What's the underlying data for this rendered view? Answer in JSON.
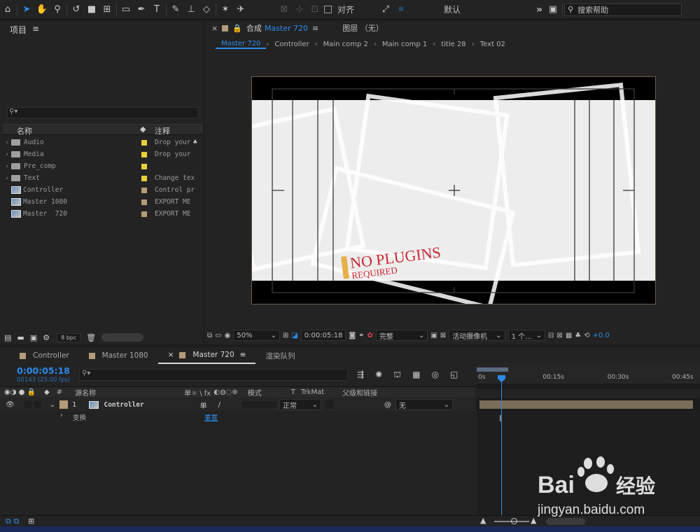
{
  "toolbar": {
    "snap_label": "对齐",
    "workspace_label": "默认",
    "search_help_placeholder": "搜索帮助",
    "expand_glyph": "»"
  },
  "project_panel": {
    "title": "项目",
    "menu_glyph": "≡",
    "columns": {
      "name": "名称",
      "comment": "注释"
    },
    "items": [
      {
        "name": "Audio",
        "type": "folder",
        "label_color": "#e6cf3c",
        "comment": "Drop your"
      },
      {
        "name": "Media",
        "type": "folder",
        "label_color": "#e6cf3c",
        "comment": "Drop your"
      },
      {
        "name": "Pre_comp",
        "type": "folder",
        "label_color": "#e6cf3c",
        "comment": ""
      },
      {
        "name": "Text",
        "type": "folder",
        "label_color": "#e6cf3c",
        "comment": "Change tex"
      },
      {
        "name": "Controller",
        "type": "comp",
        "label_color": "#b49b7a",
        "comment": "Control pr"
      },
      {
        "name": "Master 1080",
        "type": "comp",
        "label_color": "#b49b7a",
        "comment": "EXPORT ME"
      },
      {
        "name": "Master  720",
        "type": "comp",
        "label_color": "#b49b7a",
        "comment": "EXPORT ME"
      }
    ],
    "bpc": "8 bpc"
  },
  "viewer": {
    "comp_tab_prefix": "合成",
    "comp_tab_name": "Master 720",
    "comp_tab_menu": "≡",
    "layer_tab": "图层 （无）",
    "breadcrumbs": [
      "Master 720",
      "Controller",
      "Main comp 2",
      "Main comp 1",
      "title 28",
      "Text 02"
    ],
    "canvas_text_main": "NO PLUGINS",
    "canvas_text_sub": "REQUIRED",
    "zoom": "50%",
    "timecode": "0:00:05:18",
    "resolution": "完整",
    "camera": "活动摄像机",
    "views": "1 个...",
    "exposure": "+0.0"
  },
  "timeline": {
    "tabs": [
      {
        "label": "Controller",
        "active": false
      },
      {
        "label": "Master 1080",
        "active": false
      },
      {
        "label": "Master 720",
        "active": true
      },
      {
        "label": "渲染队列",
        "active": false
      }
    ],
    "close_glyph": "×",
    "timecode": "0:00:05:18",
    "fps": "00143 (25.00 fps)",
    "headers": {
      "hash": "#",
      "source_name": "源名称",
      "switches": "单☼ \\ fx",
      "mode": "模式",
      "t": "T",
      "trkmat": "TrkMat",
      "parent": "父级和链接"
    },
    "layer": {
      "index": "1",
      "name": "Controller",
      "switch": "单",
      "mode": "正常",
      "parent": "无"
    },
    "sub_row": {
      "label": "变换",
      "value": "重置"
    },
    "ruler_ticks": [
      "0s",
      "00:15s",
      "00:30s",
      "00:45s"
    ],
    "playhead_fraction": 0.05,
    "work_area": [
      0.0,
      0.14
    ]
  },
  "watermark": {
    "brand": "Bai",
    "brand_cn": "经验",
    "url": "jingyan.baidu.com"
  }
}
